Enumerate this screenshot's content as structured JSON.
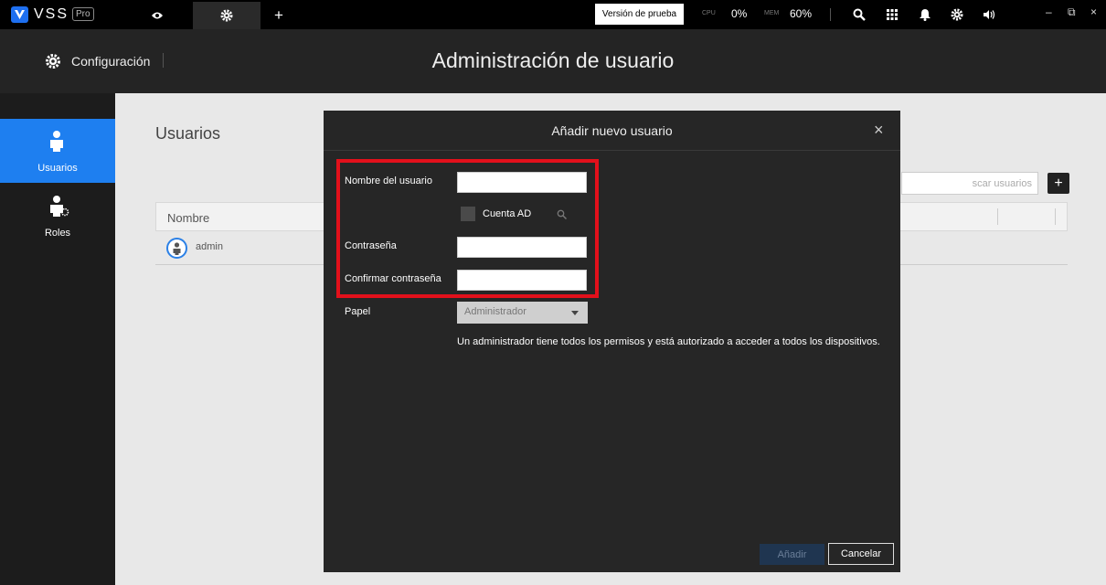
{
  "topbar": {
    "brand": "VSS",
    "brand_tag": "Pro",
    "trial_label": "Versión de prueba",
    "cpu_label": "CPU",
    "cpu_value": "0%",
    "mem_label": "MEM",
    "mem_value": "60%",
    "add_tab_glyph": "+",
    "icons": [
      "live-view-eye-icon",
      "settings-gear-icon",
      "search-icon",
      "apps-grid-icon",
      "notification-bell-icon",
      "settings-gear-icon",
      "volume-icon"
    ],
    "window_controls": {
      "minimize": "–",
      "restore": "⧉",
      "close": "×"
    }
  },
  "header": {
    "section_label": "Configuración",
    "page_title": "Administración de usuario"
  },
  "sidebar": {
    "items": [
      {
        "label": "Usuarios",
        "icon": "user-icon",
        "active": true
      },
      {
        "label": "Roles",
        "icon": "user-role-icon",
        "active": false
      }
    ]
  },
  "content": {
    "title": "Usuarios",
    "search_placeholder": "scar usuarios",
    "add_glyph": "+",
    "table": {
      "columns": [
        "Nombre"
      ],
      "rows": [
        {
          "name": "admin"
        }
      ]
    }
  },
  "dialog": {
    "title": "Añadir nuevo usuario",
    "close_glyph": "×",
    "fields": {
      "username_label": "Nombre del usuario",
      "username_value": "",
      "ad_account_label": "Cuenta AD",
      "ad_account_checked": false,
      "password_label": "Contraseña",
      "password_value": "",
      "confirm_password_label": "Confirmar contraseña",
      "confirm_password_value": "",
      "role_label": "Papel",
      "role_value": "Administrador"
    },
    "role_info": "Un administrador tiene todos los permisos y está autorizado a acceder a todos los dispositivos.",
    "add_button": "Añadir",
    "cancel_button": "Cancelar"
  },
  "colors": {
    "accent": "#1e7ff0",
    "highlight": "#e2101b",
    "dialog_bg": "#262626",
    "header_bg": "#242424",
    "sidebar_bg": "#1c1c1c",
    "content_bg": "#e8e8e8"
  }
}
